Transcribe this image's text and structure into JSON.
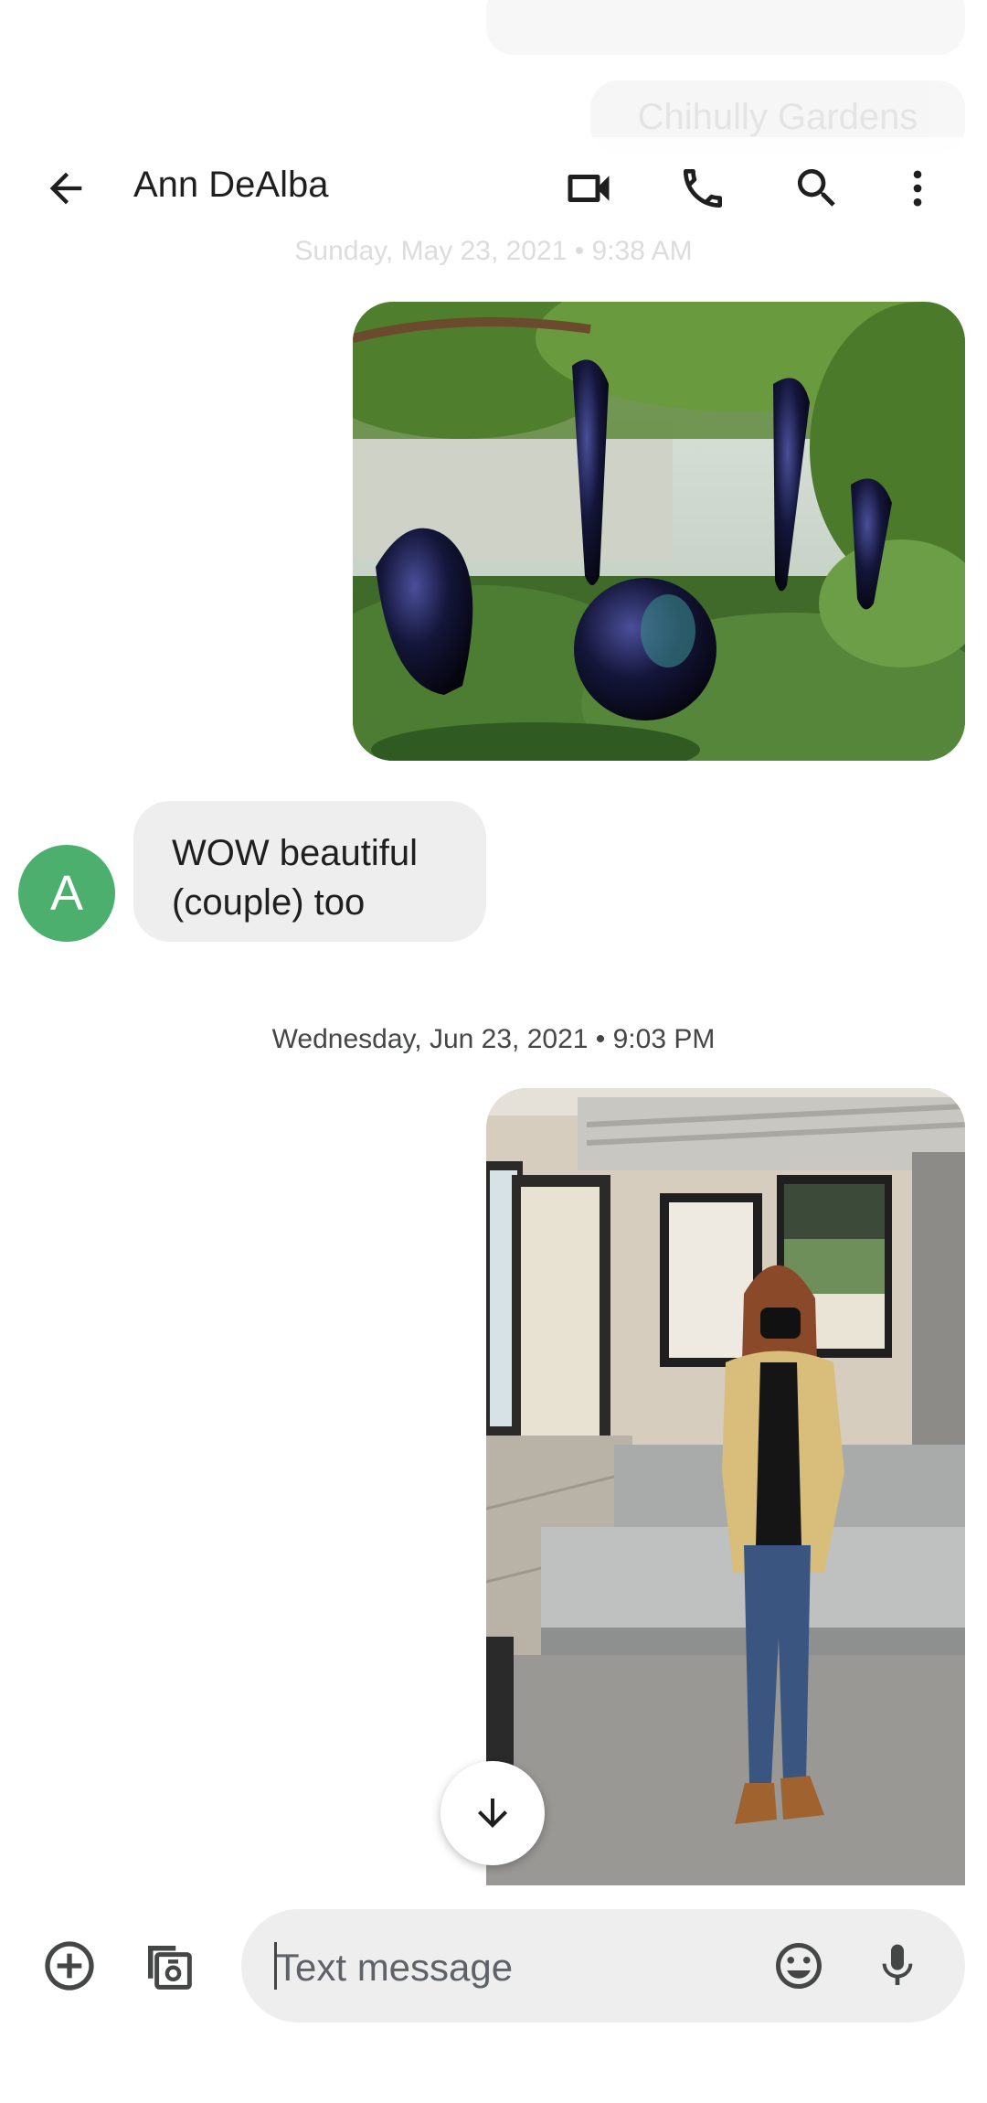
{
  "previous": {
    "caption": "Chihully Gardens",
    "date": "Sunday, May 23, 2021 • 9:38 AM"
  },
  "header": {
    "contact_name": "Ann DeAlba",
    "icons": [
      "back-arrow-icon",
      "video-call-icon",
      "phone-icon",
      "search-icon",
      "more-vert-icon"
    ]
  },
  "messages": {
    "incoming": {
      "avatar_letter": "A",
      "line1": "WOW beautiful",
      "line2": "(couple) too",
      "avatar_color": "#4caf6e"
    },
    "date_separator": "Wednesday, Jun 23, 2021 • 9:03 PM"
  },
  "compose": {
    "placeholder": "Text message",
    "icons": [
      "add-circle-icon",
      "gallery-camera-icon",
      "emoji-icon",
      "mic-icon"
    ]
  },
  "colors": {
    "bubble_incoming": "#eeeeee",
    "compose_field": "#eeeeee",
    "text_primary": "#1f1f1f"
  }
}
